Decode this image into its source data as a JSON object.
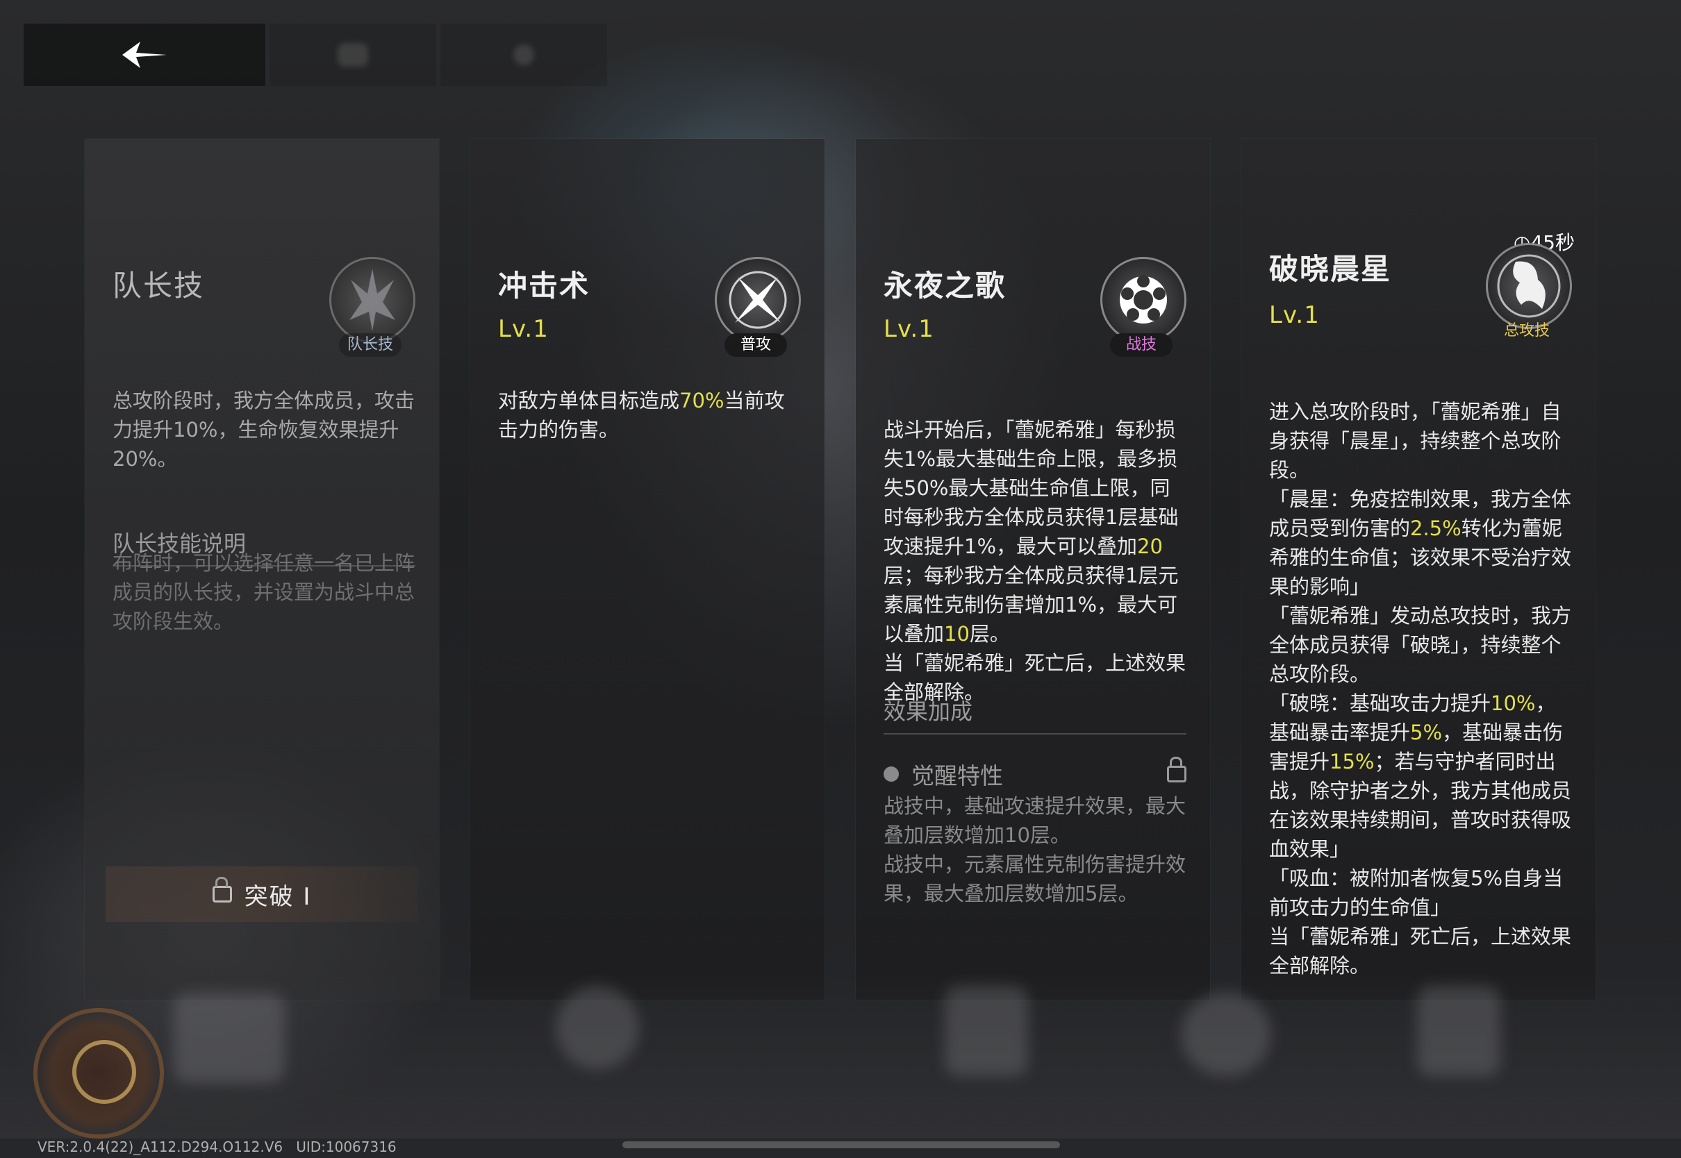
{
  "top_bar": {
    "back_icon": "back-arrow-icon"
  },
  "panels": [
    {
      "title": "队长技",
      "tag": "队长技",
      "icon": "captain-emblem-icon",
      "desc": "总攻阶段时，我方全体成员，攻击力提升10%，生命恢复效果提升20%。",
      "section_title": "队长技能说明",
      "section_text": "布阵时，可以选择任意一名已上阵成员的队长技，并设置为战斗中总攻阶段生效。",
      "breakthrough_label": "突破 Ⅰ"
    },
    {
      "title": "冲击术",
      "level": "Lv.1",
      "tag": "普攻",
      "icon": "cross-blade-icon",
      "desc_parts": [
        "对敌方单体目标造成",
        "70%",
        "当前攻击力的伤害。"
      ]
    },
    {
      "title": "永夜之歌",
      "level": "Lv.1",
      "tag": "战技",
      "icon": "flower-burst-icon",
      "desc_parts": [
        "战斗开始后，「蕾妮希雅」每秒损失1%最大基础生命上限，最多损失50%最大基础生命值上限，同时每秒我方全体成员获得1层基础攻速提升1%，最大可以叠加",
        "20",
        "层；每秒我方全体成员获得1层元素属性克制伤害增加1%，最大可以叠加",
        "10",
        "层。\n当「蕾妮希雅」死亡后，上述效果全部解除。"
      ],
      "section_title": "效果加成",
      "awaken_label": "觉醒特性",
      "awaken_text": "战技中，基础攻速提升效果，最大叠加层数增加10层。\n战技中，元素属性克制伤害提升效果，最大叠加层数增加5层。"
    },
    {
      "title": "破晓晨星",
      "level": "Lv.1",
      "tag": "总攻技",
      "icon": "morning-star-icon",
      "timer": "45秒",
      "desc_parts": [
        "进入总攻阶段时，「蕾妮希雅」自身获得「晨星」，持续整个总攻阶段。\n「晨星：免疫控制效果，我方全体成员受到伤害的",
        "2.5%",
        "转化为蕾妮希雅的生命值；该效果不受治疗效果的影响」\n「蕾妮希雅」发动总攻技时，我方全体成员获得「破晓」，持续整个总攻阶段。\n「破晓：基础攻击力提升",
        "10%",
        "，基础暴击率提升",
        "5%",
        "，基础暴击伤害提升",
        "15%",
        "；若与守护者同时出战，除守护者之外，我方其他成员在该效果持续期间，普攻时获得吸血效果」\n「吸血：被附加者恢复5%自身当前攻击力的生命值」\n当「蕾妮希雅」死亡后，上述效果全部解除。"
      ]
    }
  ],
  "footer": {
    "version": "VER:2.0.4(22)_A112.D294.O112.V6",
    "uid": "UID:10067316"
  },
  "colors": {
    "highlight": "#e4e04a",
    "tag_skill": "#e07ae0",
    "tag_ult": "#e8c84a",
    "tag_captain": "#a8b8d0"
  }
}
